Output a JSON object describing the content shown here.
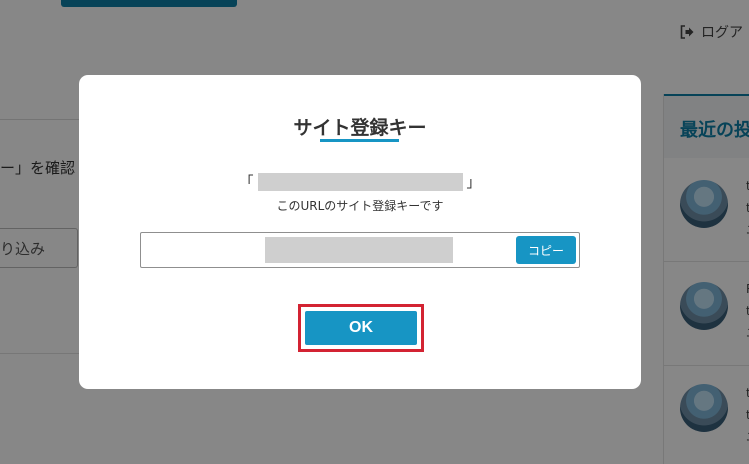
{
  "header": {
    "logout_label": "ログア"
  },
  "left": {
    "confirm_text": "ー」を確認",
    "filter_text": "り込み"
  },
  "right_panel": {
    "heading": "最近の投",
    "posts": [
      {
        "line1": "t",
        "line2": "t",
        "line3": "ユ"
      },
      {
        "line1": "R",
        "line2": "t",
        "line3": "ユ"
      },
      {
        "line1": "t",
        "line2": "t",
        "line3": "ユ"
      }
    ]
  },
  "modal": {
    "title": "サイト登録キー",
    "bracket_open": "「",
    "bracket_close": "」",
    "description": "このURLのサイト登録キーです",
    "copy_label": "コピー",
    "ok_label": "OK"
  },
  "colors": {
    "accent": "#1795c4",
    "highlight": "#d32332",
    "dark_accent": "#0f7fa6"
  },
  "icons": {
    "logout": "sign-out-icon"
  }
}
